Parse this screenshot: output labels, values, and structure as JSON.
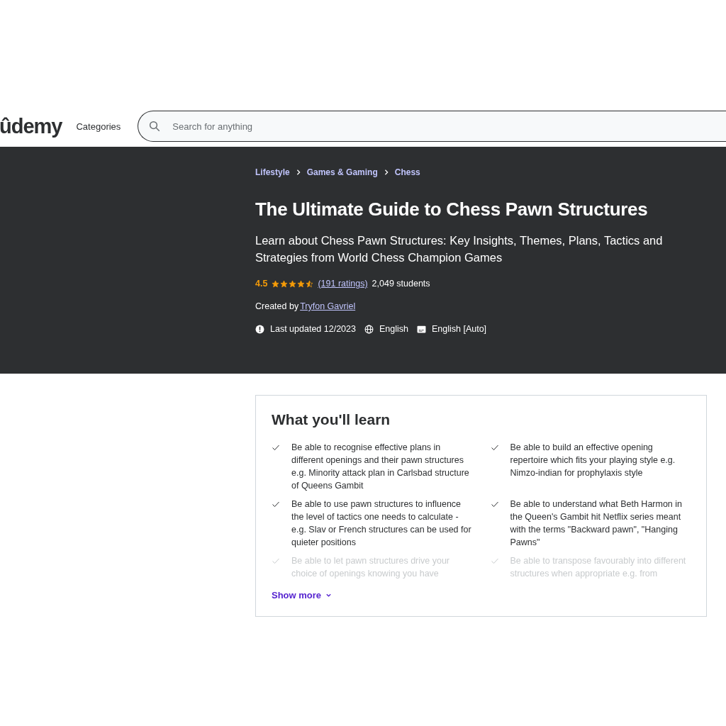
{
  "header": {
    "logo": "ûdemy",
    "categories": "Categories",
    "search": {
      "placeholder": "Search for anything"
    }
  },
  "hero": {
    "breadcrumbs": [
      "Lifestyle",
      "Games & Gaming",
      "Chess"
    ],
    "title": "The Ultimate Guide to Chess Pawn Structures",
    "subtitle": "Learn about Chess Pawn Structures: Key Insights, Themes, Plans, Tactics and Strategies from World Chess Champion Games",
    "rating": "4.5",
    "stars": 4.5,
    "ratings_link": "(191 ratings)",
    "students": "2,049 students",
    "created_by": "Created by",
    "author": "Tryfon Gavriel",
    "last_updated": "Last updated 12/2023",
    "language": "English",
    "captions": "English [Auto]"
  },
  "learn": {
    "title": "What you'll learn",
    "items": [
      {
        "text": "Be able to recognise effective plans in different openings and their pawn structures e.g. Minority attack plan in Carlsbad structure of Queens Gambit",
        "faded": false
      },
      {
        "text": "Be able to build an effective opening repertoire which fits your playing style e.g. Nimzo-indian for prophylaxis style",
        "faded": false
      },
      {
        "text": "Be able to use pawn structures to influence the level of tactics one needs to calculate - e.g. Slav or French structures can be used for quieter positions",
        "faded": false
      },
      {
        "text": "Be able to understand what Beth Harmon in the Queen's Gambit hit Netflix series meant with the terms \"Backward pawn\", \"Hanging Pawns\"",
        "faded": false
      },
      {
        "text": "Be able to let pawn structures drive your choice of openings knowing you have",
        "faded": true
      },
      {
        "text": "Be able to transpose favourably into different structures when appropriate e.g. from",
        "faded": true
      }
    ],
    "show_more": "Show more"
  }
}
